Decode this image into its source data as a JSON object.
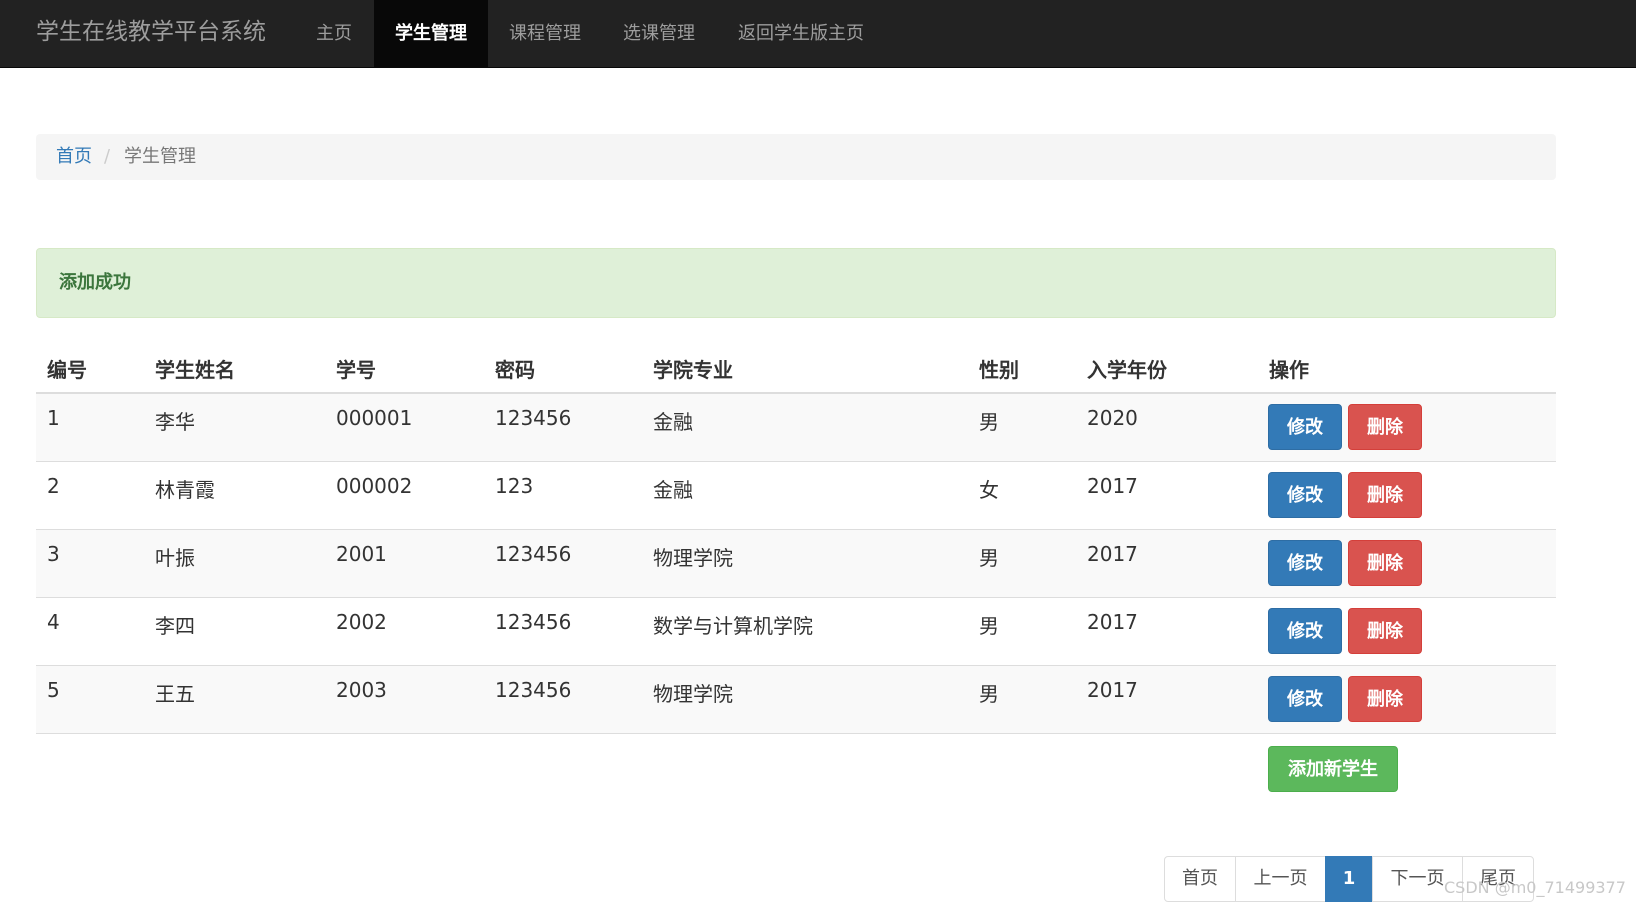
{
  "navbar": {
    "brand": "学生在线教学平台系统",
    "items": [
      {
        "label": "主页",
        "active": false
      },
      {
        "label": "学生管理",
        "active": true
      },
      {
        "label": "课程管理",
        "active": false
      },
      {
        "label": "选课管理",
        "active": false
      },
      {
        "label": "返回学生版主页",
        "active": false
      }
    ]
  },
  "breadcrumb": {
    "home": "首页",
    "separator": "/",
    "current": "学生管理"
  },
  "alert": {
    "message": "添加成功"
  },
  "table": {
    "headers": [
      "编号",
      "学生姓名",
      "学号",
      "密码",
      "学院专业",
      "性别",
      "入学年份",
      "操作"
    ],
    "rows": [
      {
        "id": "1",
        "name": "李华",
        "student_no": "000001",
        "password": "123456",
        "major": "金融",
        "gender": "男",
        "year": "2020"
      },
      {
        "id": "2",
        "name": "林青霞",
        "student_no": "000002",
        "password": "123",
        "major": "金融",
        "gender": "女",
        "year": "2017"
      },
      {
        "id": "3",
        "name": "叶振",
        "student_no": "2001",
        "password": "123456",
        "major": "物理学院",
        "gender": "男",
        "year": "2017"
      },
      {
        "id": "4",
        "name": "李四",
        "student_no": "2002",
        "password": "123456",
        "major": "数学与计算机学院",
        "gender": "男",
        "year": "2017"
      },
      {
        "id": "5",
        "name": "王五",
        "student_no": "2003",
        "password": "123456",
        "major": "物理学院",
        "gender": "男",
        "year": "2017"
      }
    ],
    "edit_label": "修改",
    "delete_label": "删除",
    "add_label": "添加新学生"
  },
  "pagination": {
    "first": "首页",
    "prev": "上一页",
    "current": "1",
    "next": "下一页",
    "last": "尾页"
  },
  "watermark": "CSDN @m0_71499377",
  "colors": {
    "navbar_bg": "#222222",
    "primary": "#337ab7",
    "danger": "#d9534f",
    "success": "#5cb85c",
    "alert_bg": "#dff0d8",
    "alert_text": "#3c763d"
  }
}
